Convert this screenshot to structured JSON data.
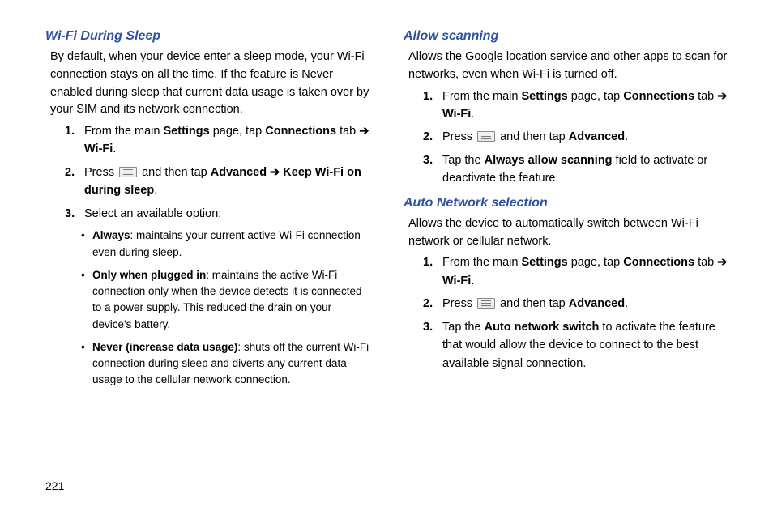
{
  "pageNumber": "221",
  "left": {
    "wifiSleep": {
      "heading": "Wi-Fi During Sleep",
      "intro": "By default, when your device enter a sleep mode, your Wi-Fi connection stays on all the time. If the feature is Never enabled during sleep that current data usage is taken over by your SIM and its network connection.",
      "step1_a": "From the main ",
      "step1_b": "Settings",
      "step1_c": " page, tap ",
      "step1_d": "Connections",
      "step1_e": " tab ",
      "arrow": "➔",
      "step1_f": "Wi-Fi",
      "period": ".",
      "step2_a": "Press ",
      "step2_b": " and then tap ",
      "step2_c": "Advanced ➔ Keep Wi-Fi on during sleep",
      "step3": "Select an available option:",
      "bullet1_a": "Always",
      "bullet1_b": ": maintains your current active Wi-Fi connection even during sleep.",
      "bullet2_a": "Only when plugged in",
      "bullet2_b": ": maintains the active Wi-Fi connection only when the device detects it is connected to a power supply. This reduced the drain on your device's battery.",
      "bullet3_a": "Never (increase data usage)",
      "bullet3_b": ": shuts off the current Wi-Fi connection during sleep and diverts any current data usage to the cellular network connection."
    }
  },
  "right": {
    "allowScanning": {
      "heading": "Allow scanning",
      "intro": "Allows the Google location service and other apps to scan for networks, even when Wi-Fi is turned off.",
      "step1_a": "From the main ",
      "step1_b": "Settings",
      "step1_c": " page, tap ",
      "step1_d": "Connections",
      "step1_e": " tab ",
      "arrow": "➔",
      "step1_f": "Wi-Fi",
      "period": ".",
      "step2_a": "Press ",
      "step2_b": " and then tap ",
      "step2_c": "Advanced",
      "step3_a": "Tap the ",
      "step3_b": "Always allow scanning",
      "step3_c": " field to activate or deactivate the feature."
    },
    "autoNetwork": {
      "heading": "Auto Network selection",
      "intro": "Allows the device to automatically switch between Wi-Fi network or cellular network.",
      "step1_a": "From the main ",
      "step1_b": "Settings",
      "step1_c": " page, tap ",
      "step1_d": "Connections",
      "step1_e": " tab ",
      "arrow": "➔",
      "step1_f": "Wi-Fi",
      "period": ".",
      "step2_a": "Press ",
      "step2_b": " and then tap ",
      "step2_c": "Advanced",
      "step3_a": "Tap the ",
      "step3_b": "Auto network switch",
      "step3_c": " to activate the feature that would allow the device to connect to the best available signal connection."
    }
  }
}
